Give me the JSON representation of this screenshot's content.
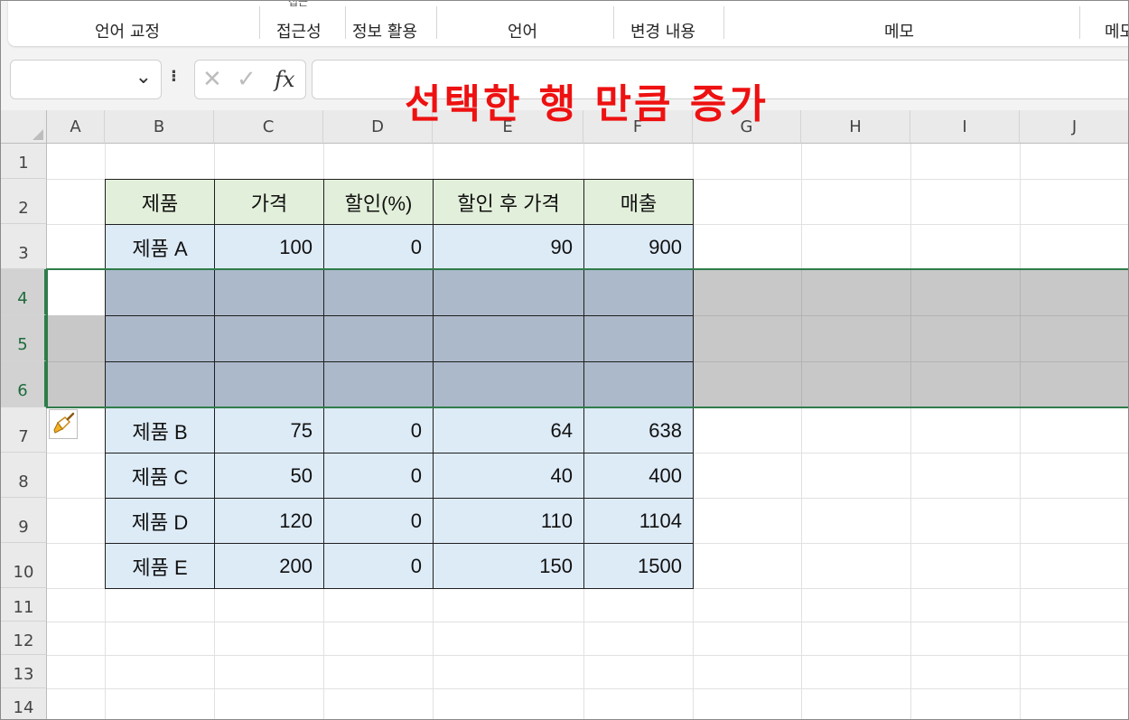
{
  "ribbon": {
    "groups": [
      "언어 교정",
      "접근성",
      "정보 활용",
      "언어",
      "변경 내용",
      "메모",
      "메모"
    ],
    "top_fragment": "접근"
  },
  "formula_bar": {
    "name_box": "",
    "fx_label": "fx",
    "cancel_symbol": "✕",
    "enter_symbol": "✓",
    "formula": ""
  },
  "annotation": {
    "text": "선택한 행 만큼 증가",
    "color": "#ee1111"
  },
  "columns": [
    "A",
    "B",
    "C",
    "D",
    "E",
    "F",
    "G",
    "H",
    "I",
    "J"
  ],
  "rows": [
    "1",
    "2",
    "3",
    "4",
    "5",
    "6",
    "7",
    "8",
    "9",
    "10",
    "11",
    "12",
    "13",
    "14"
  ],
  "selected_rows": [
    "4",
    "5",
    "6"
  ],
  "table": {
    "headers": [
      "제품",
      "가격",
      "할인(%)",
      "할인 후 가격",
      "매출"
    ],
    "row_3": [
      "제품 A",
      "100",
      "0",
      "90",
      "900"
    ],
    "row_7": [
      "제품 B",
      "75",
      "0",
      "64",
      "638"
    ],
    "row_8": [
      "제품 C",
      "50",
      "0",
      "40",
      "400"
    ],
    "row_9": [
      "제품 D",
      "120",
      "0",
      "110",
      "1104"
    ],
    "row_10": [
      "제품 E",
      "200",
      "0",
      "150",
      "1500"
    ]
  },
  "colors": {
    "header_fill": "#e2efda",
    "data_fill": "#ddebf7",
    "inserted_fill": "#acb9ca",
    "selection_fill": "#c8c8c8",
    "selection_border": "#2f7d4a"
  },
  "icons": {
    "insert_options": "paintbrush-icon",
    "name_box_dropdown": "chevron-down-icon"
  }
}
